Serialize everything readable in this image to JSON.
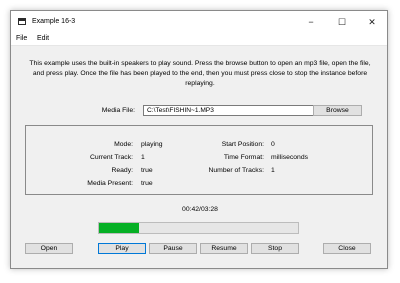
{
  "window": {
    "title": "Example 16-3",
    "controls": {
      "minimize": "−",
      "maximize": "☐",
      "close": "✕"
    }
  },
  "menu": {
    "file": "File",
    "edit": "Edit"
  },
  "description": "This example uses the built-in speakers to play sound. Press the browse button to open an mp3 file, open the file, and press play. Once the file has been played to the end, then you must press close to stop the instance before replaying.",
  "media_file": {
    "label": "Media File:",
    "value": "C:\\Test\\FISHIN~1.MP3",
    "browse_label": "Browse"
  },
  "info": {
    "mode_label": "Mode:",
    "mode_value": "playing",
    "current_track_label": "Current Track:",
    "current_track_value": "1",
    "ready_label": "Ready:",
    "ready_value": "true",
    "media_present_label": "Media Present:",
    "media_present_value": "true",
    "start_position_label": "Start Position:",
    "start_position_value": "0",
    "time_format_label": "Time Format:",
    "time_format_value": "milliseconds",
    "number_of_tracks_label": "Number of Tracks:",
    "number_of_tracks_value": "1"
  },
  "time_display": "00:42/03:28",
  "progress": {
    "fraction": 0.2,
    "color": "#06b025"
  },
  "buttons": {
    "open": "Open",
    "play": "Play",
    "pause": "Pause",
    "resume": "Resume",
    "stop": "Stop",
    "close": "Close"
  }
}
